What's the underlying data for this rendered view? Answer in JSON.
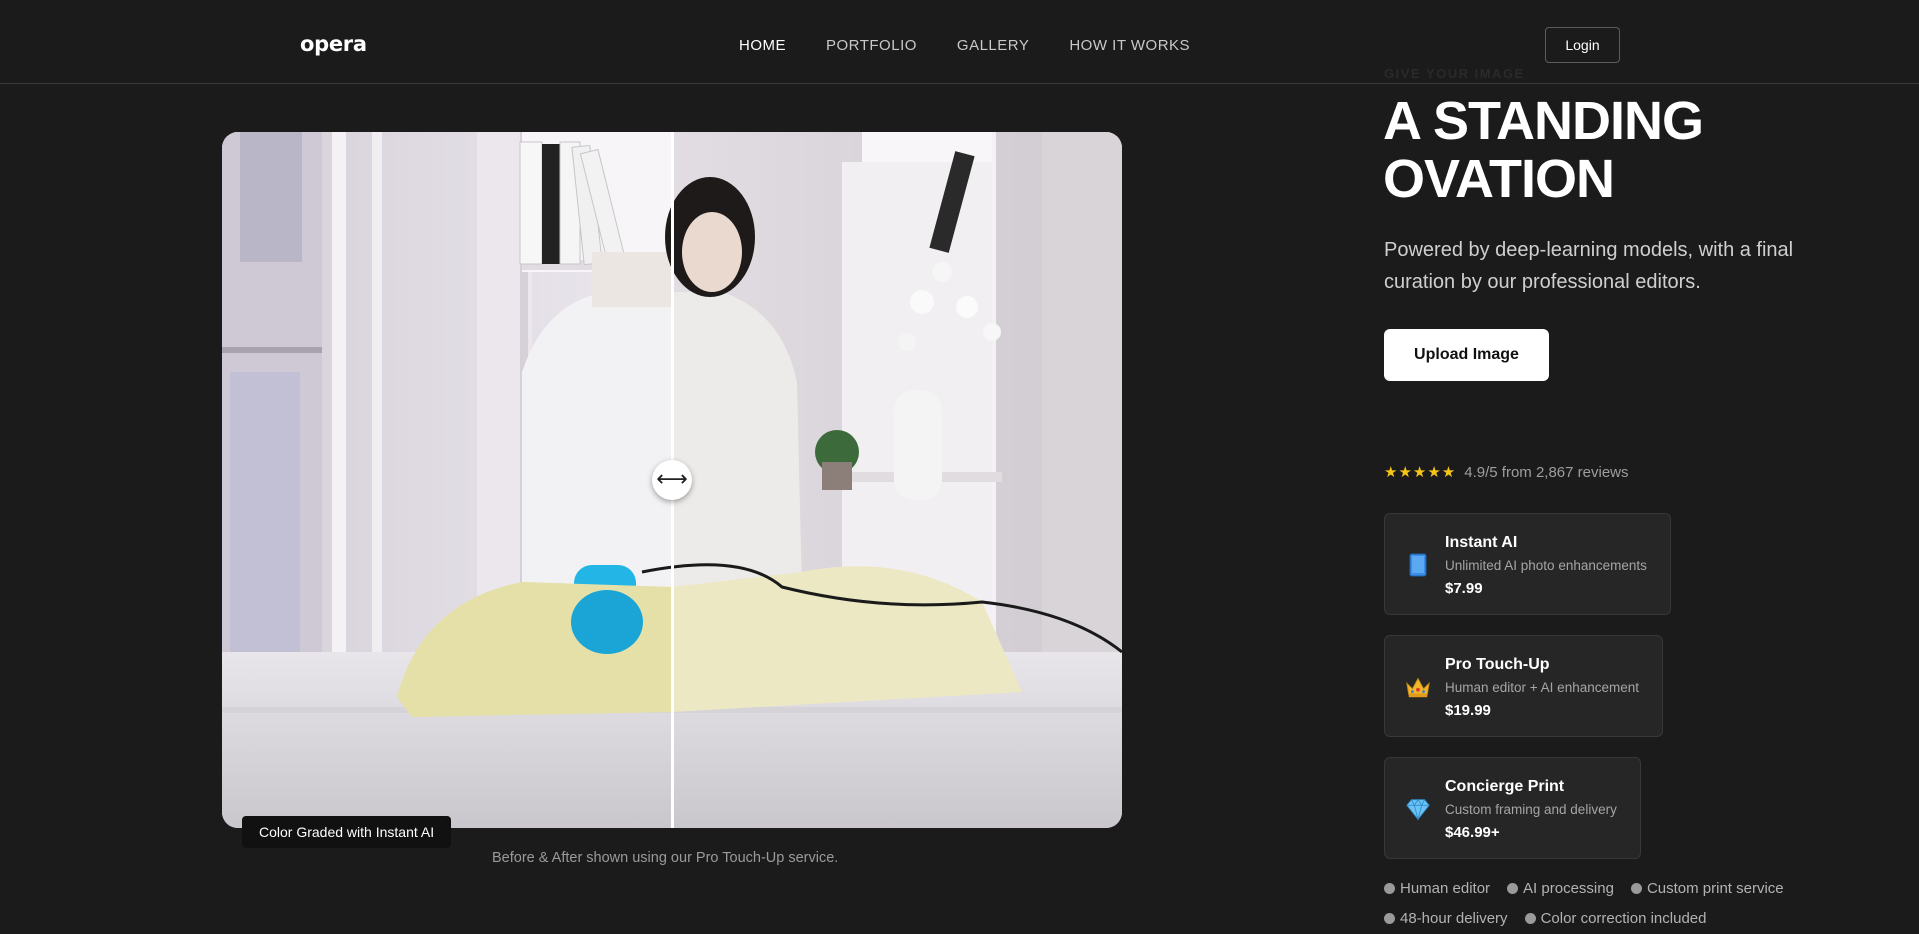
{
  "header": {
    "logo": "opera",
    "nav": [
      "HOME",
      "PORTFOLIO",
      "GALLERY",
      "HOW IT WORKS"
    ],
    "login_label": "Login"
  },
  "compare": {
    "label": "Color Graded with Instant AI",
    "caption": "Before & After shown using our Pro Touch-Up service.",
    "handle_icon": "⟷"
  },
  "hero": {
    "eyebrow": "GIVE YOUR IMAGE",
    "title": "A STANDING OVATION",
    "subtitle": "Powered by deep-learning models, with a final curation by our professional editors.",
    "upload_label": "Upload Image",
    "stars": "★★★★★",
    "rating_text": "4.9/5 from 2,867 reviews"
  },
  "plans": [
    {
      "icon": "tablet-icon",
      "name": "Instant AI",
      "desc": "Unlimited AI photo enhancements",
      "price": "$7.99"
    },
    {
      "icon": "crown-icon",
      "name": "Pro Touch-Up",
      "desc": "Human editor + AI enhancement",
      "price": "$19.99"
    },
    {
      "icon": "diamond-icon",
      "name": "Concierge Print",
      "desc": "Custom framing and delivery",
      "price": "$46.99+"
    }
  ],
  "features": [
    "Human editor",
    "AI processing",
    "Custom print service",
    "48-hour delivery",
    "Color correction included"
  ],
  "colors": {
    "background": "#1b1b1b",
    "card": "#262626",
    "star": "#f5c518",
    "accent_blue": "#1aa5d6"
  }
}
